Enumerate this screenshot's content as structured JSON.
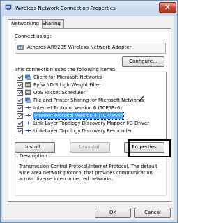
{
  "window": {
    "title": "Wireless Network Connection Properties",
    "close_glyph": "X"
  },
  "tabs": [
    {
      "label": "Networking",
      "active": true
    },
    {
      "label": "Sharing",
      "active": false
    }
  ],
  "connect_using": {
    "label": "Connect using:",
    "adapter": "Atheros AR9285 Wireless Network Adapter",
    "configure_label": "Configure..."
  },
  "items_label": "This connection uses the following items:",
  "items": [
    {
      "label": "Client for Microsoft Networks",
      "checked": true,
      "icon": "network-client-icon"
    },
    {
      "label": "Epfw NDIS LightWeight Filter",
      "checked": true,
      "icon": "network-service-icon"
    },
    {
      "label": "QoS Packet Scheduler",
      "checked": true,
      "icon": "network-service-icon"
    },
    {
      "label": "File and Printer Sharing for Microsoft Networks",
      "checked": true,
      "icon": "network-client-icon"
    },
    {
      "label": "Internet Protocol Version 6 (TCP/IPv6)",
      "checked": true,
      "icon": "protocol-icon"
    },
    {
      "label": "Internet Protocol Version 4 (TCP/IPv4)",
      "checked": true,
      "icon": "protocol-icon",
      "selected": true
    },
    {
      "label": "Link-Layer Topology Discovery Mapper I/O Driver",
      "checked": true,
      "icon": "protocol-icon"
    },
    {
      "label": "Link-Layer Topology Discovery Responder",
      "checked": true,
      "icon": "protocol-icon"
    }
  ],
  "annotation_check": "✓",
  "buttons": {
    "install": "Install...",
    "uninstall": "Uninstall",
    "properties": "Properties",
    "ok": "OK",
    "cancel": "Cancel"
  },
  "description": {
    "title": "Description",
    "text": "Transmission Control Protocol/Internet Protocol. The default wide area network protocol that provides communication across diverse interconnected networks."
  },
  "colors": {
    "selection": "#3399ff",
    "title_bar": "#cfdff0",
    "close_button": "#c2422b"
  }
}
